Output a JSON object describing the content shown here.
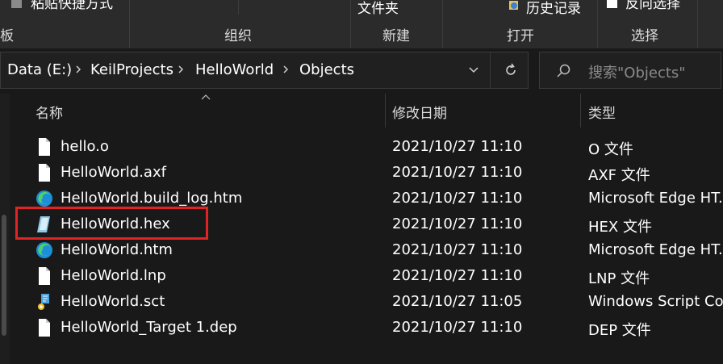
{
  "ribbon": {
    "top_partial_1": "粘贴快捷方式",
    "top_partial_2": "文件夹",
    "history_label": "历史记录",
    "select_partial": "反向选择",
    "groups": {
      "clipboard_partial": "板",
      "organize": "组织",
      "new": "新建",
      "open": "打开",
      "select": "选择"
    }
  },
  "address": {
    "crumbs": [
      "Data (E:)",
      "KeilProjects",
      "HelloWorld",
      "Objects"
    ]
  },
  "search": {
    "placeholder": "搜索\"Objects\""
  },
  "columns": {
    "name": "名称",
    "modified": "修改日期",
    "type": "类型"
  },
  "files": [
    {
      "name": "hello.o",
      "date": "2021/10/27 11:10",
      "type": "O 文件",
      "icon": "blank-file-icon"
    },
    {
      "name": "HelloWorld.axf",
      "date": "2021/10/27 11:10",
      "type": "AXF 文件",
      "icon": "blank-file-icon"
    },
    {
      "name": "HelloWorld.build_log.htm",
      "date": "2021/10/27 11:10",
      "type": "Microsoft Edge HT...",
      "icon": "edge-icon"
    },
    {
      "name": "HelloWorld.hex",
      "date": "2021/10/27 11:10",
      "type": "HEX 文件",
      "icon": "hex-file-icon"
    },
    {
      "name": "HelloWorld.htm",
      "date": "2021/10/27 11:10",
      "type": "Microsoft Edge HT...",
      "icon": "edge-icon"
    },
    {
      "name": "HelloWorld.lnp",
      "date": "2021/10/27 11:10",
      "type": "LNP 文件",
      "icon": "blank-file-icon"
    },
    {
      "name": "HelloWorld.sct",
      "date": "2021/10/27 11:05",
      "type": "Windows Script Co...",
      "icon": "script-file-icon"
    },
    {
      "name": "HelloWorld_Target 1.dep",
      "date": "2021/10/27 11:10",
      "type": "DEP 文件",
      "icon": "blank-file-icon"
    }
  ],
  "colors": {
    "highlight": "#e02424",
    "background": "#191919",
    "ribbon": "#2b2b2b"
  }
}
